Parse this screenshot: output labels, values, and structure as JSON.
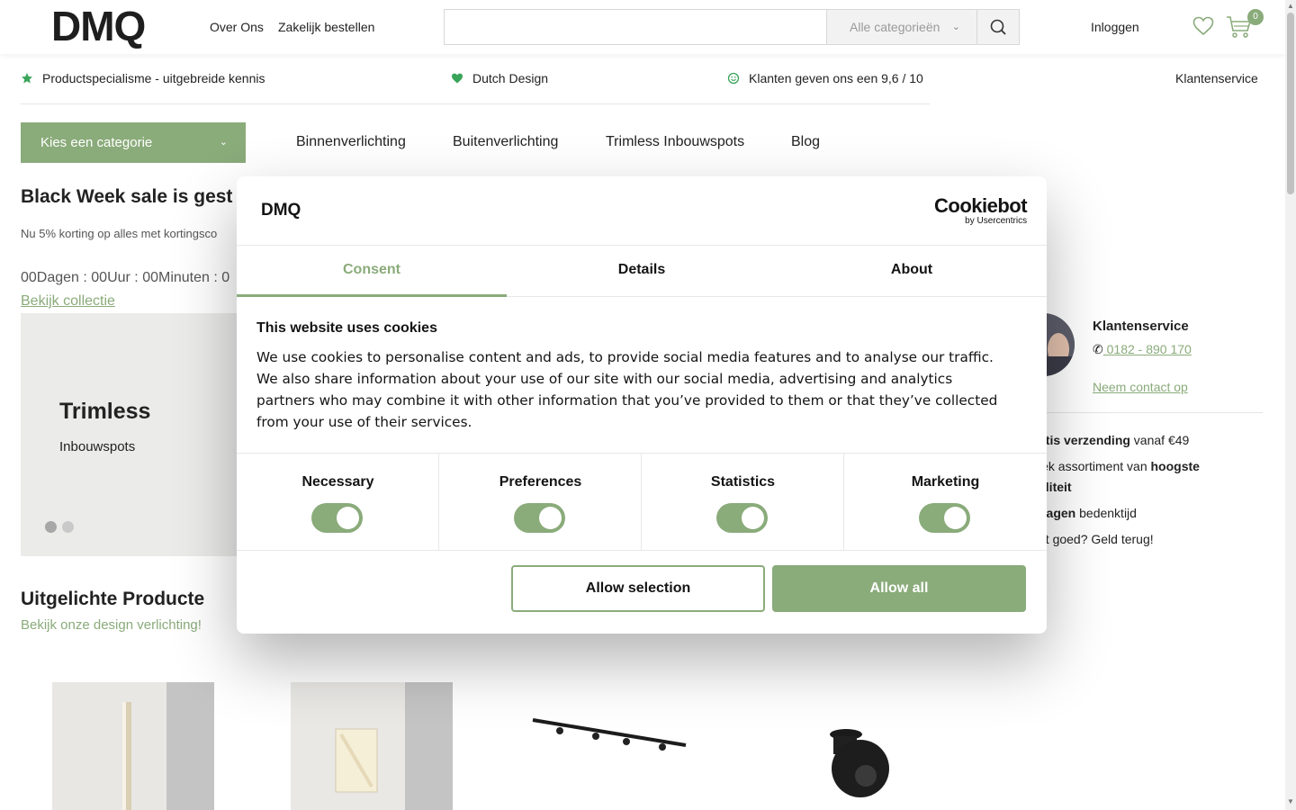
{
  "header": {
    "logo": "DMQ",
    "nav": [
      "Over Ons",
      "Zakelijk bestellen"
    ],
    "search_placeholder": "",
    "search_category": "Alle categorieën",
    "login": "Inloggen",
    "cart_count": "0"
  },
  "usp": {
    "items": [
      {
        "label": "Productspecialisme - uitgebreide kennis",
        "icon": "star-icon"
      },
      {
        "label": "Dutch Design",
        "icon": "heart-icon"
      },
      {
        "label": "Klanten geven ons een 9,6 / 10",
        "icon": "smiley-icon"
      }
    ],
    "service": "Klantenservice"
  },
  "catnav": {
    "button": "Kies een categorie",
    "links": [
      "Binnenverlichting",
      "Buitenverlichting",
      "Trimless Inbouwspots",
      "Blog"
    ]
  },
  "promo": {
    "title": "Black Week sale is gest",
    "subtitle": "Nu 5% korting op alles met kortingsco",
    "countdown": "00Dagen : 00Uur : 00Minuten : 0",
    "link": "Bekijk collectie"
  },
  "slider": {
    "title": "Trimless",
    "subtitle": "Inbouwspots"
  },
  "featured": {
    "title": "Uitgelichte Producte",
    "subtitle": "Bekijk onze design verlichting!"
  },
  "sidebar": {
    "title": "Klantenservice",
    "phone": " 0182 - 890 170",
    "contact": "Neem contact op",
    "benefits": [
      {
        "strong": "atis verzending",
        "rest": " vanaf €49"
      },
      {
        "pre": "iek assortiment van ",
        "strong": "hoogste"
      },
      {
        "strong": "aliteit",
        "rest": ""
      },
      {
        "strong": "dagen",
        "rest": " bedenktijd"
      },
      {
        "pre": "et goed? Geld terug!",
        "strong": ""
      }
    ]
  },
  "cookie": {
    "brand": "DMQ",
    "provider": "Cookiebot",
    "provider_by": "by Usercentrics",
    "tabs": [
      "Consent",
      "Details",
      "About"
    ],
    "heading": "This website uses cookies",
    "body": "We use cookies to personalise content and ads, to provide social media features and to analyse our traffic. We also share information about your use of our site with our social media, advertising and analytics partners who may combine it with other information that you’ve provided to them or that they’ve collected from your use of their services.",
    "toggles": [
      "Necessary",
      "Preferences",
      "Statistics",
      "Marketing"
    ],
    "allow_selection": "Allow selection",
    "allow_all": "Allow all"
  },
  "colors": {
    "accent": "#8aab7a",
    "text": "#222222"
  }
}
